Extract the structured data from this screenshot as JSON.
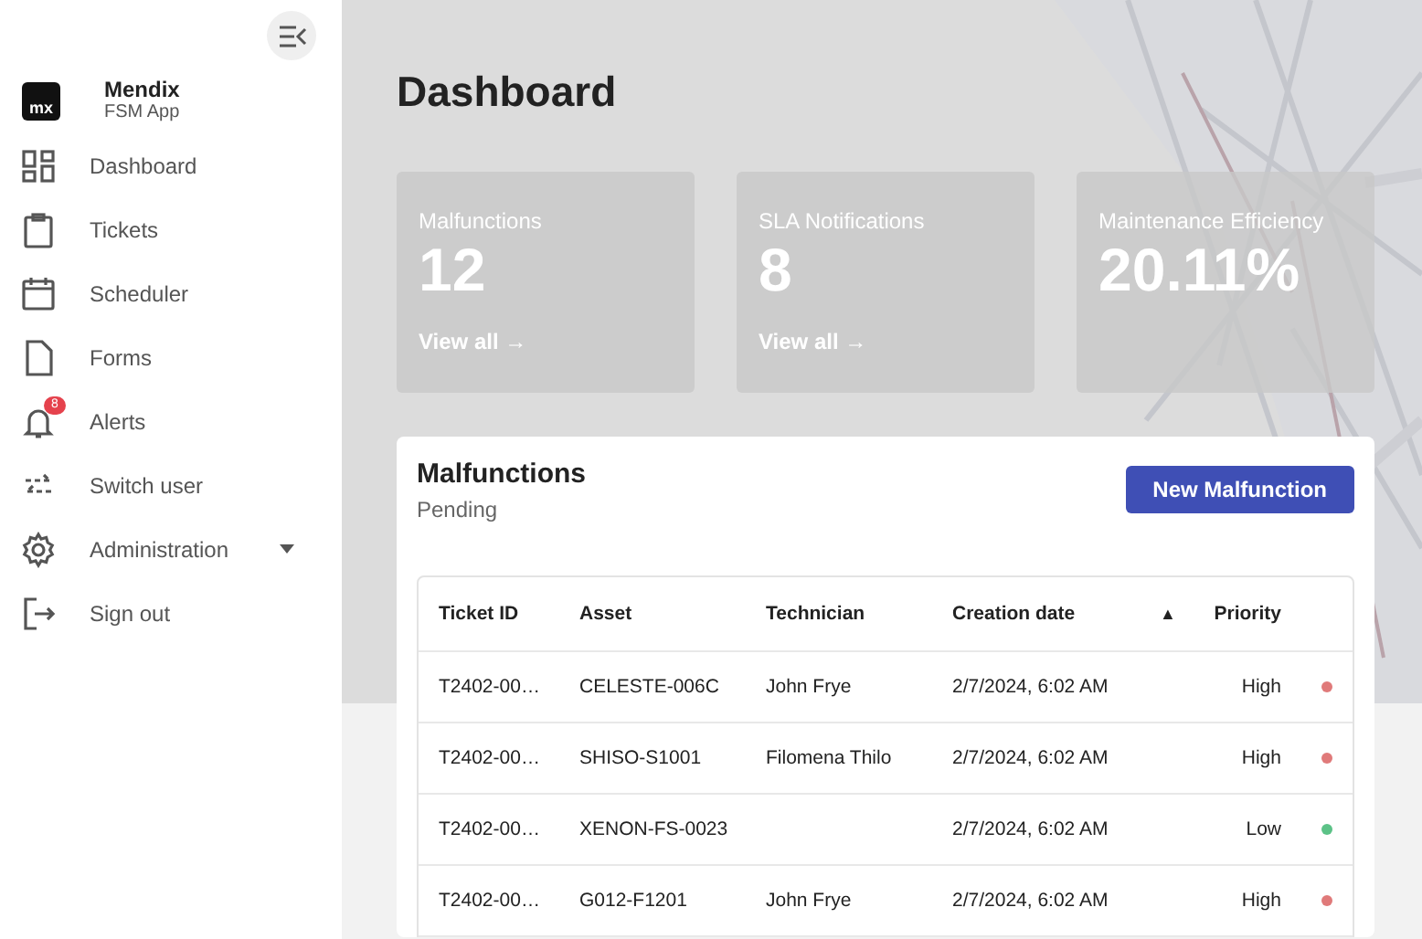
{
  "sidebar": {
    "brand": {
      "logo": "mx",
      "name": "Mendix",
      "subtitle": "FSM App"
    },
    "items": [
      {
        "label": "Dashboard"
      },
      {
        "label": "Tickets"
      },
      {
        "label": "Scheduler"
      },
      {
        "label": "Forms"
      },
      {
        "label": "Alerts",
        "badge": "8"
      },
      {
        "label": "Switch user"
      },
      {
        "label": "Administration",
        "expandable": true
      },
      {
        "label": "Sign out"
      }
    ]
  },
  "page": {
    "title": "Dashboard"
  },
  "stats": [
    {
      "label": "Malfunctions",
      "value": "12",
      "link": "View all →"
    },
    {
      "label": "SLA Notifications",
      "value": "8",
      "link": "View all →"
    },
    {
      "label": "Maintenance Efficiency",
      "value": "20.11%"
    }
  ],
  "panel": {
    "title": "Malfunctions",
    "subtitle": "Pending",
    "button": "New Malfunction"
  },
  "table": {
    "columns": [
      "Ticket ID",
      "Asset",
      "Technician",
      "Creation date",
      "▲",
      "Priority"
    ],
    "rows": [
      {
        "cells": [
          "T2402-00…",
          "CELESTE-006C",
          "John Frye",
          "2/7/2024, 6:02 AM",
          "High"
        ],
        "color": "#e07a7a"
      },
      {
        "cells": [
          "T2402-00…",
          "SHISO-S1001",
          "Filomena Thilo",
          "2/7/2024, 6:02 AM",
          "High"
        ],
        "color": "#e07a7a"
      },
      {
        "cells": [
          "T2402-00…",
          "XENON-FS-0023",
          "",
          "2/7/2024, 6:02 AM",
          "Low"
        ],
        "color": "#5cc287"
      },
      {
        "cells": [
          "T2402-00…",
          "G012-F1201",
          "John Frye",
          "2/7/2024, 6:02 AM",
          "High"
        ],
        "color": "#e07a7a"
      }
    ]
  }
}
